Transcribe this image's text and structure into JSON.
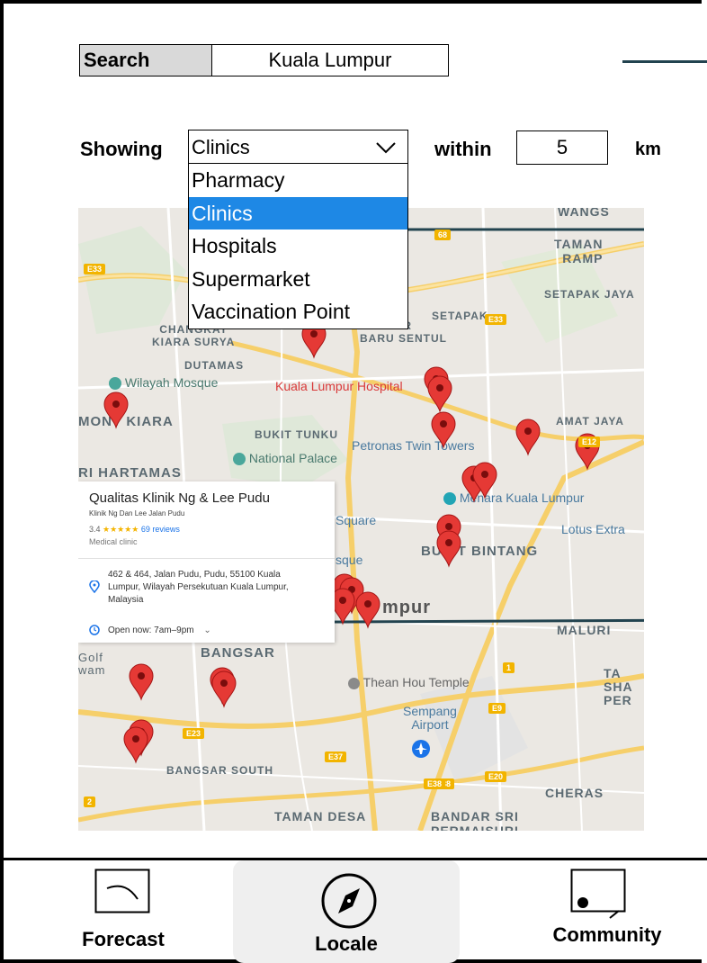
{
  "search": {
    "label": "Search",
    "value": "Kuala Lumpur"
  },
  "filter": {
    "showing_label": "Showing",
    "selected": "Clinics",
    "options": [
      "Pharmacy",
      "Clinics",
      "Hospitals",
      "Supermarket",
      "Vaccination Point"
    ],
    "within_label": "within",
    "distance": "5",
    "unit": "km"
  },
  "map": {
    "labels": {
      "wangsa": "WANGS",
      "taman_rampai": "TAMAN\nRAMP",
      "setapak_jaya": "SETAPAK JAYA",
      "setapak": "SETAPAK",
      "changkat": "CHANGKAT\nKIARA SURYA",
      "bandar_baru_sentul": "BANDAR\nBARU SENTUL",
      "dutamas": "DUTAMAS",
      "mont_kiara": "MONT KIARA",
      "bukit_tunku": "BUKIT TUNKU",
      "taman_jaya": "AMAT JAYA",
      "sri_hartamas": "RI HARTAMAS",
      "bukit_bintang": "BUKIT BINTANG",
      "maluri": "MALURI",
      "bangsar": "BANGSAR",
      "bangsar_south": "BANGSAR SOUTH",
      "taman_desa": "TAMAN DESA",
      "bandar_sri_permaisuri": "BANDAR SRI\nPERMAISURI",
      "cheras": "CHERAS",
      "lumpur": "mpur",
      "tashi": "TA\nSHA\nPER",
      "golf": "Golf\nwam"
    },
    "pois": {
      "wilayah_mosque": "Wilayah Mosque",
      "kl_hospital": "Kuala Lumpur Hospital",
      "petronas": "Petronas Twin Towers",
      "national_palace": "National Palace",
      "menara": "Menara Kuala Lumpur",
      "lotus": "Lotus Extra",
      "square": "Square",
      "mosque": "sque",
      "thean_hou": "Thean Hou Temple",
      "sempang": "Sempang\nAirport"
    },
    "road_codes": [
      "E33",
      "68",
      "E33",
      "E12",
      "E23",
      "E37",
      "E9",
      "E38",
      "E20",
      "E38",
      "1",
      "2"
    ],
    "info_card": {
      "title": "Qualitas Klinik Ng & Lee Pudu",
      "subtitle": "Klinik Ng Dan Lee Jalan Pudu",
      "rating": "3.4",
      "stars": "★★★★★",
      "reviews": "69 reviews",
      "type": "Medical clinic",
      "address": "462 & 464, Jalan Pudu, Pudu, 55100 Kuala Lumpur, Wilayah Persekutuan Kuala Lumpur, Malaysia",
      "hours": "Open now:  7am–9pm"
    }
  },
  "nav": {
    "forecast": "Forecast",
    "locale": "Locale",
    "community": "Community"
  }
}
